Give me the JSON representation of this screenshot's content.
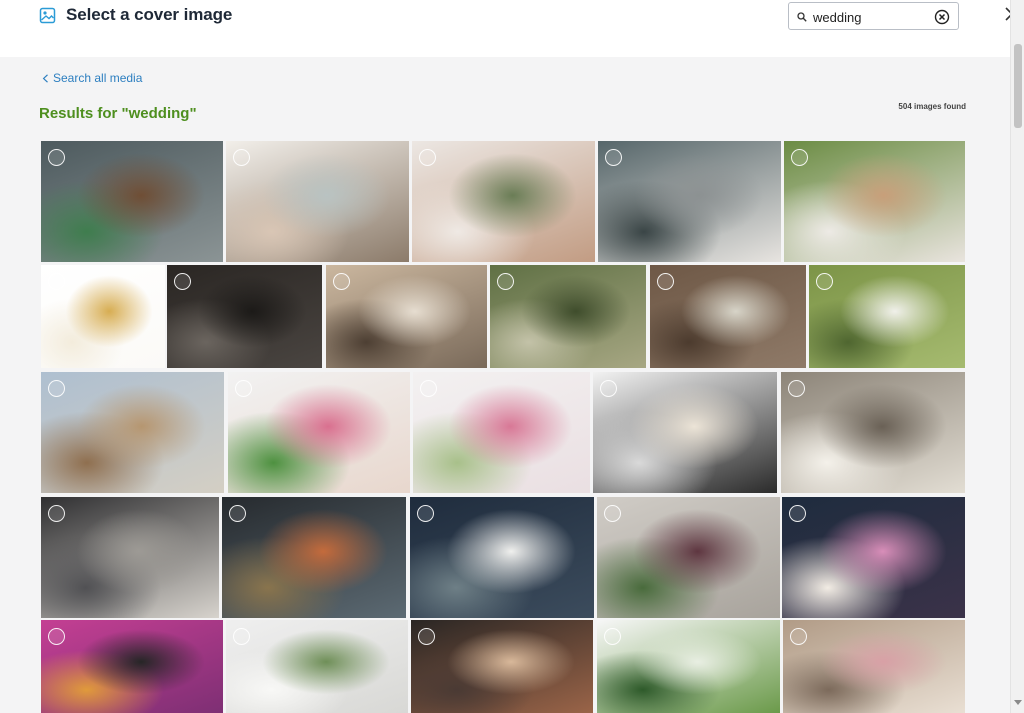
{
  "header": {
    "title": "Select a cover image",
    "search_value": "wedding",
    "icons": {
      "title": "image-icon",
      "search": "search-icon",
      "clear": "clear-icon",
      "close": "close-icon"
    }
  },
  "main": {
    "back_link": "Search all media",
    "results_title": "Results for \"wedding\"",
    "count": "504 images found"
  },
  "images": [
    {
      "subject": "couple sitting on boat bow",
      "colors": [
        "#4d5a5e",
        "#8b9495",
        "#6f4e35",
        "#3f7d4e"
      ]
    },
    {
      "subject": "smiling couple embracing by lake",
      "colors": [
        "#f2efea",
        "#8c7b6a",
        "#b9c3c2",
        "#d9c6b5"
      ]
    },
    {
      "subject": "couple cuddling close-up",
      "colors": [
        "#ece7e3",
        "#c29c83",
        "#6a7d56",
        "#efe9e4"
      ]
    },
    {
      "subject": "couple kissing in boat",
      "colors": [
        "#56666a",
        "#e7e4e0",
        "#8c9192",
        "#3a4546"
      ]
    },
    {
      "subject": "woman hugging man from behind",
      "colors": [
        "#6b8c43",
        "#e9e4de",
        "#c89f7a",
        "#edeae5"
      ]
    },
    {
      "subject": "gold wedding rings",
      "colors": [
        "#ffffff",
        "#fbfaf7",
        "#d7ad52",
        "#f3ecdc"
      ]
    },
    {
      "subject": "rings on dark surface",
      "colors": [
        "#2a2623",
        "#4a4541",
        "#1c1a18",
        "#6b655f"
      ]
    },
    {
      "subject": "banquet table setting",
      "colors": [
        "#cbb79f",
        "#7a6a5a",
        "#e6ddd0",
        "#4d3f33"
      ]
    },
    {
      "subject": "couple kissing among greenery",
      "colors": [
        "#5f7044",
        "#a7a783",
        "#3f4d2c",
        "#c3c2a8"
      ]
    },
    {
      "subject": "flower bouquet on wood",
      "colors": [
        "#6e5846",
        "#8f7a68",
        "#d7d4c8",
        "#4c3b2e"
      ]
    },
    {
      "subject": "cake topper figurines",
      "colors": [
        "#7c9447",
        "#a6bb70",
        "#f0f0ea",
        "#4f6630"
      ]
    },
    {
      "subject": "couple walking in field",
      "colors": [
        "#aebfd0",
        "#d4cfc4",
        "#b69670",
        "#8f6f4f"
      ]
    },
    {
      "subject": "pink rose bouquet in hands",
      "colors": [
        "#f2f2f2",
        "#e8d7cd",
        "#d9708f",
        "#4e9140"
      ]
    },
    {
      "subject": "pink flowers on white",
      "colors": [
        "#f3f1f1",
        "#eadfe2",
        "#d87896",
        "#a8c08a"
      ]
    },
    {
      "subject": "bride and groom cupcakes",
      "colors": [
        "#f2f2f2",
        "#2b2b2b",
        "#ece4d7",
        "#d9d9d9"
      ]
    },
    {
      "subject": "bride and groom shoes",
      "colors": [
        "#8c8478",
        "#e2ddd3",
        "#6a6156",
        "#f4f1ea"
      ]
    },
    {
      "subject": "vintage car with cans",
      "colors": [
        "#2f2f31",
        "#d7d3cd",
        "#9d9a95",
        "#515154"
      ]
    },
    {
      "subject": "groomsmen in suits",
      "colors": [
        "#262a2e",
        "#5c6a73",
        "#c46b3c",
        "#89744d"
      ]
    },
    {
      "subject": "groom with boutonniere",
      "colors": [
        "#1f2c3d",
        "#3c4c5d",
        "#f0f0ee",
        "#6e7f86"
      ]
    },
    {
      "subject": "bouquet against brick wall",
      "colors": [
        "#d0ccc6",
        "#a8a39c",
        "#5e3640",
        "#496b3c"
      ]
    },
    {
      "subject": "bridesmaids with corsages",
      "colors": [
        "#1e2c3e",
        "#3b3249",
        "#d88eb9",
        "#f2ece4"
      ]
    },
    {
      "subject": "groom at decorated stage",
      "colors": [
        "#c43f93",
        "#7e2f74",
        "#262626",
        "#e09a3b"
      ]
    },
    {
      "subject": "reception table flowers",
      "colors": [
        "#efefef",
        "#d8d8d5",
        "#6f8f58",
        "#f8f8f6"
      ]
    },
    {
      "subject": "wine glasses toast",
      "colors": [
        "#2a2624",
        "#9a6448",
        "#d8b89a",
        "#4a3a34"
      ]
    },
    {
      "subject": "outdoor ceremony",
      "colors": [
        "#f7f7f7",
        "#6b9a4a",
        "#e8eee2",
        "#2e5a2a"
      ]
    },
    {
      "subject": "bridal shoes and bouquet",
      "colors": [
        "#b19b86",
        "#e9dfd3",
        "#d8a0a6",
        "#7c6a5b"
      ]
    }
  ]
}
